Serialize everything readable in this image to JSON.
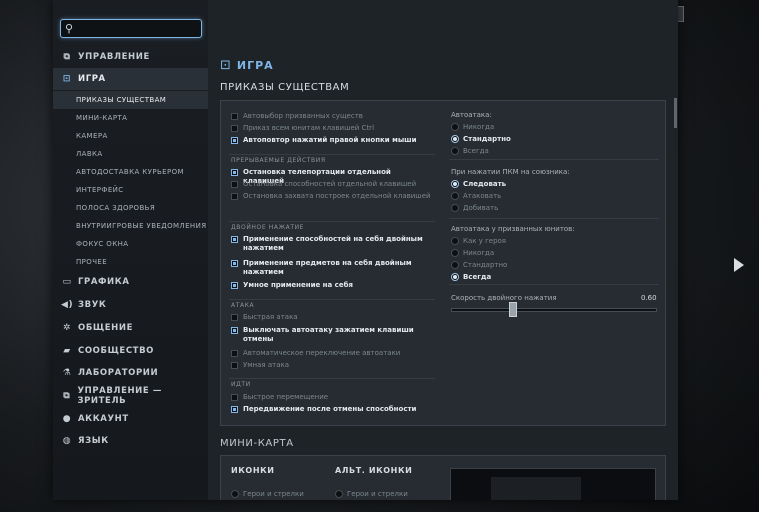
{
  "search": {
    "placeholder": ""
  },
  "close_label": "✕",
  "sidebar": {
    "items": [
      {
        "id": "controls",
        "label": "УПРАВЛЕНИЕ",
        "icon": "⧉"
      },
      {
        "id": "game",
        "label": "ИГРА",
        "icon": "⊡",
        "active": true
      },
      {
        "id": "graphics",
        "label": "ГРАФИКА",
        "icon": "▭"
      },
      {
        "id": "sound",
        "label": "ЗВУК",
        "icon": "◀)"
      },
      {
        "id": "social",
        "label": "ОБЩЕНИЕ",
        "icon": "✲"
      },
      {
        "id": "community",
        "label": "СООБЩЕСТВО",
        "icon": "▰"
      },
      {
        "id": "labs",
        "label": "ЛАБОРАТОРИИ",
        "icon": "⚗"
      },
      {
        "id": "spectator",
        "label": "УПРАВЛЕНИЕ — ЗРИТЕЛЬ",
        "icon": "⧉"
      },
      {
        "id": "account",
        "label": "АККАУНТ",
        "icon": "●"
      },
      {
        "id": "language",
        "label": "ЯЗЫК",
        "icon": "◍"
      }
    ],
    "subitems": [
      {
        "label": "ПРИКАЗЫ СУЩЕСТВАМ",
        "active": true
      },
      {
        "label": "МИНИ-КАРТА"
      },
      {
        "label": "КАМЕРА"
      },
      {
        "label": "ЛАВКА"
      },
      {
        "label": "АВТОДОСТАВКА КУРЬЕРОМ"
      },
      {
        "label": "ИНТЕРФЕЙС"
      },
      {
        "label": "ПОЛОСА ЗДОРОВЬЯ"
      },
      {
        "label": "ВНУТРИИГРОВЫЕ УВЕДОМЛЕНИЯ"
      },
      {
        "label": "ФОКУС ОКНА"
      },
      {
        "label": "ПРОЧЕЕ"
      }
    ]
  },
  "content": {
    "section_title": "ИГРА",
    "subsection_title": "ПРИКАЗЫ СУЩЕСТВАМ",
    "left": {
      "general": [
        {
          "label": "Автовыбор призванных существ",
          "checked": false
        },
        {
          "label": "Приказ всем юнитам клавишей Ctrl",
          "checked": false
        },
        {
          "label": "Автоповтор нажатий правой кнопки мыши",
          "checked": true
        }
      ],
      "interrupt_title": "ПРЕРЫВАЕМЫЕ ДЕЙСТВИЯ",
      "interrupt": [
        {
          "label": "Остановка телепортации отдельной клавишей",
          "checked": true
        },
        {
          "label": "Остановка способностей отдельной клавишей",
          "checked": false
        },
        {
          "label": "Остановка захвата построек отдельной клавишей",
          "checked": false
        }
      ],
      "double_title": "ДВОЙНОЕ НАЖАТИЕ",
      "double": [
        {
          "label": "Применение способностей на себя двойным нажатием",
          "checked": true
        },
        {
          "label": "Применение предметов на себя двойным нажатием",
          "checked": true
        },
        {
          "label": "Умное применение на себя",
          "checked": true
        }
      ],
      "attack_title": "АТАКА",
      "attack": [
        {
          "label": "Быстрая атака",
          "checked": false
        },
        {
          "label": "Выключать автоатаку зажатием клавиши отмены",
          "checked": true
        },
        {
          "label": "Автоматическое переключение автоатаки",
          "checked": false
        },
        {
          "label": "Умная атака",
          "checked": false
        }
      ],
      "move_title": "ИДТИ",
      "move": [
        {
          "label": "Быстрое перемещение",
          "checked": false
        },
        {
          "label": "Передвижение после отмены способности",
          "checked": true
        }
      ]
    },
    "right": {
      "autoattack_label": "Автоатака:",
      "autoattack": [
        {
          "label": "Никогда",
          "selected": false
        },
        {
          "label": "Стандартно",
          "selected": true
        },
        {
          "label": "Всегда",
          "selected": false
        }
      ],
      "rmb_label": "При нажатии ПКМ на союзника:",
      "rmb": [
        {
          "label": "Следовать",
          "selected": true
        },
        {
          "label": "Атаковать",
          "selected": false
        },
        {
          "label": "Добивать",
          "selected": false
        }
      ],
      "summon_label": "Автоатака у призванных юнитов:",
      "summon": [
        {
          "label": "Как у героя",
          "selected": false
        },
        {
          "label": "Никогда",
          "selected": false
        },
        {
          "label": "Стандартно",
          "selected": false
        },
        {
          "label": "Всегда",
          "selected": true
        }
      ],
      "double_speed_label": "Скорость двойного нажатия",
      "double_speed_value": "0.60"
    },
    "minimap": {
      "title": "МИНИ-КАРТА",
      "col1_title": "ИКОНКИ",
      "col2_title": "АЛЬТ. ИКОНКИ",
      "col1_option": "Герои и стрелки",
      "col2_option": "Герои и стрелки"
    }
  }
}
